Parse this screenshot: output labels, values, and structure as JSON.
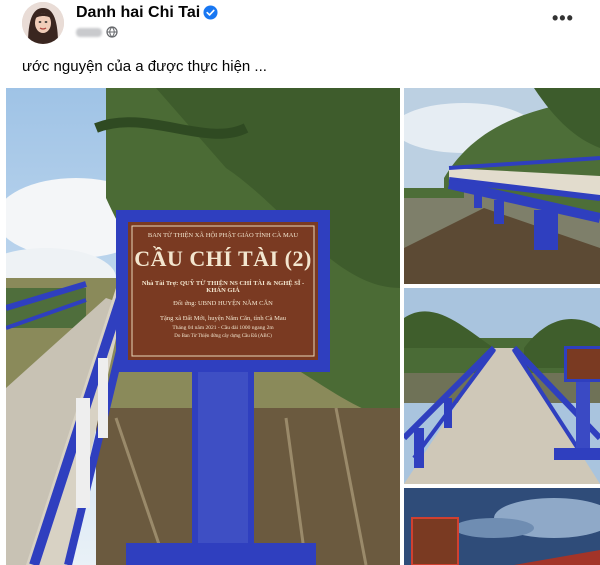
{
  "post": {
    "author_name": "Danh hai Chi Tai",
    "caption": "ước nguyện của a được thực hiện ...",
    "more_label": "•••",
    "verified_icon": "verified-badge-icon",
    "privacy_icon": "globe-icon"
  },
  "sign": {
    "org_line": "BAN TỪ THIỆN XÃ HỘI PHẬT GIÁO TỈNH CÀ MAU",
    "title": "CẦU CHÍ TÀI (2)",
    "sponsor": "Nhà Tài Trợ: QUỸ TỪ THIỆN NS CHÍ TÀI & NGHỆ SĨ - KHÁN GIẢ",
    "partner": "Đối ứng: UBND HUYỆN NĂM CĂN",
    "gift": "Tặng xã Đất Mới, huyện Năm Căn, tỉnh Cà Mau",
    "date": "Tháng 04 năm 2021 - Cầu dài 1000 ngang 2m",
    "note": "Do Ban Từ Thiện đứng cây dựng Cầu Đã (ABC)"
  },
  "colors": {
    "bridge_blue": "#2f3fbf",
    "sign_brown": "#7a3a22",
    "verified_blue": "#1877f2"
  }
}
